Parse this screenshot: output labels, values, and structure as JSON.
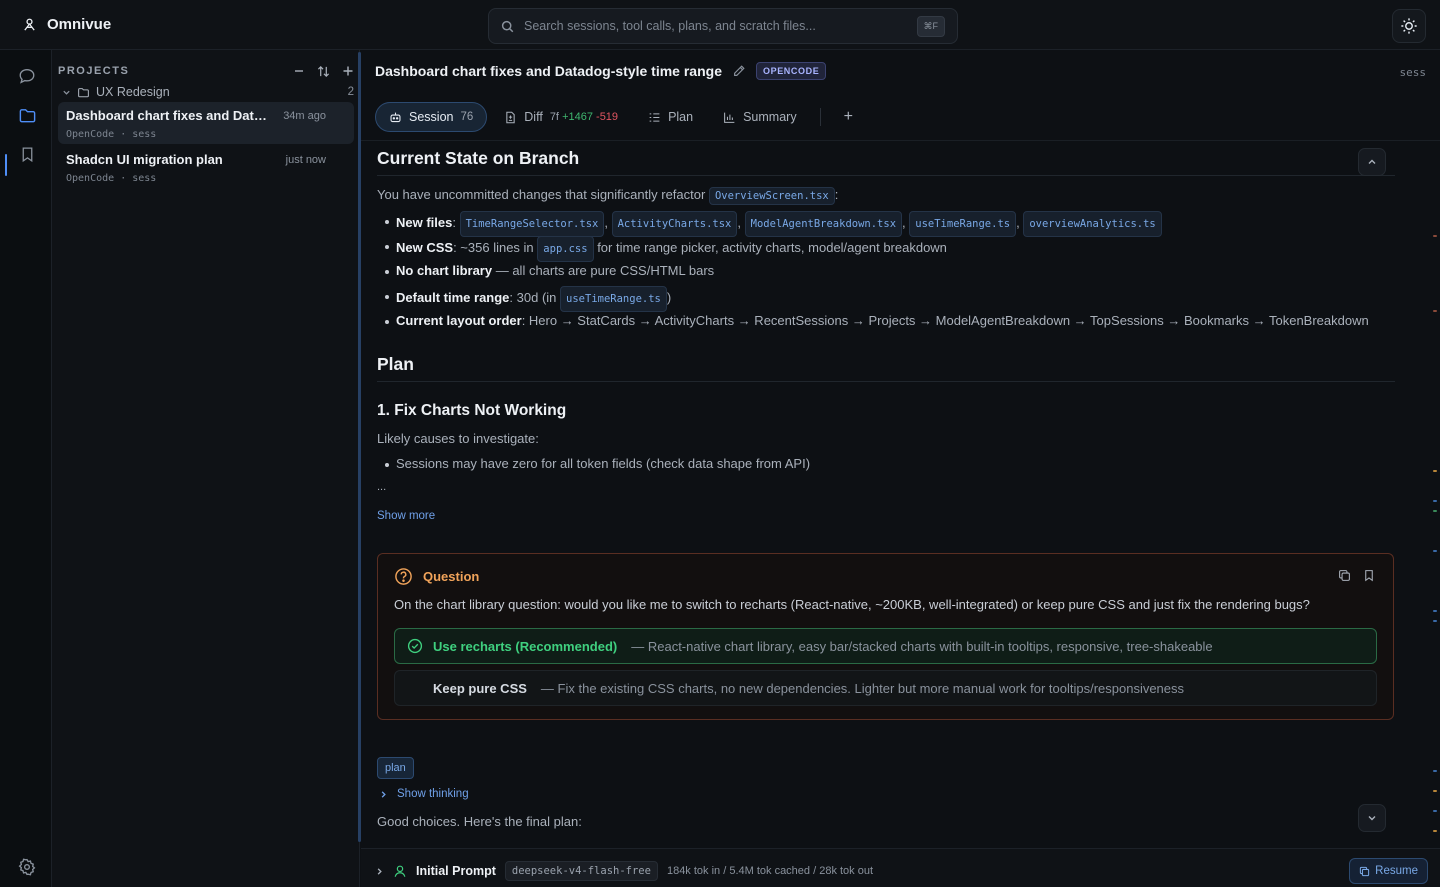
{
  "app": {
    "name": "Omnivue"
  },
  "search": {
    "placeholder": "Search sessions, tool calls, plans, and scratch files...",
    "shortcut": "⌘F"
  },
  "projects": {
    "header": "PROJECTS",
    "group": {
      "name": "UX Redesign",
      "count": "2"
    },
    "sessions": [
      {
        "title": "Dashboard chart fixes and Data...",
        "time": "34m ago",
        "agent": "OpenCode",
        "tag": "sess"
      },
      {
        "title": "Shadcn UI migration plan",
        "time": "just now",
        "agent": "OpenCode",
        "tag": "sess"
      }
    ]
  },
  "session": {
    "title": "Dashboard chart fixes and Datadog-style time range",
    "badge": "OPENCODE",
    "corner_tag": "sess"
  },
  "tabs": {
    "session": {
      "label": "Session",
      "count": "76"
    },
    "diff": {
      "label": "Diff",
      "files": "7f",
      "added": "+1467",
      "removed": "-519"
    },
    "plan": {
      "label": "Plan"
    },
    "summary": {
      "label": "Summary"
    },
    "add": "+"
  },
  "doc": {
    "h_state": "Current State on Branch",
    "intro_pre": "You have uncommitted changes that significantly refactor",
    "intro_code": "OverviewScreen.tsx",
    "intro_post": ":",
    "new_files_label": "New files",
    "new_files": [
      "TimeRangeSelector.tsx",
      "ActivityCharts.tsx",
      "ModelAgentBreakdown.tsx",
      "useTimeRange.ts",
      "overviewAnalytics.ts"
    ],
    "new_css_label": "New CSS",
    "new_css_pre": ": ~356 lines in",
    "new_css_code": "app.css",
    "new_css_post": "for time range picker, activity charts, model/agent breakdown",
    "no_chart_label": "No chart library",
    "no_chart_text": "— all charts are pure CSS/HTML bars",
    "default_range_label": "Default time range",
    "default_range_pre": ": 30d (in",
    "default_range_code": "useTimeRange.ts",
    "default_range_post": ")",
    "layout_label": "Current layout order",
    "layout_text": ": Hero → StatCards → ActivityCharts → RecentSessions → Projects → ModelAgentBreakdown → TopSessions → Bookmarks → TokenBreakdown",
    "h_plan": "Plan",
    "h_fix": "1. Fix Charts Not Working",
    "likely": "Likely causes to investigate:",
    "cause1": "Sessions may have zero for all token fields (check data shape from API)",
    "ellipsis": "...",
    "show_more": "Show more"
  },
  "question": {
    "title": "Question",
    "text": "On the chart library question: would you like me to switch to recharts (React-native, ~200KB, well-integrated) or keep pure CSS and just fix the rendering bugs?",
    "options": [
      {
        "label": "Use recharts (Recommended)",
        "desc": "— React-native chart library, easy bar/stacked charts with built-in tooltips, responsive, tree-shakeable",
        "selected": true
      },
      {
        "label": "Keep pure CSS",
        "desc": "— Fix the existing CSS charts, no new dependencies. Lighter but more manual work for tooltips/responsiveness",
        "selected": false
      }
    ]
  },
  "after": {
    "chip": "plan",
    "show_thinking": "Show thinking",
    "good_choices": "Good choices. Here's the final plan:"
  },
  "bottom": {
    "title": "Initial Prompt",
    "model": "deepseek-v4-flash-free",
    "stats": "184k tok in / 5.4M tok cached / 28k tok out",
    "resume": "Resume"
  },
  "colors": {
    "accent": "#4f8ef7",
    "question_border": "#5a2e22",
    "question_title": "#f0a35a",
    "selected_option": "#3fd07f",
    "diff_add": "#3fb66f",
    "diff_del": "#e05561"
  }
}
